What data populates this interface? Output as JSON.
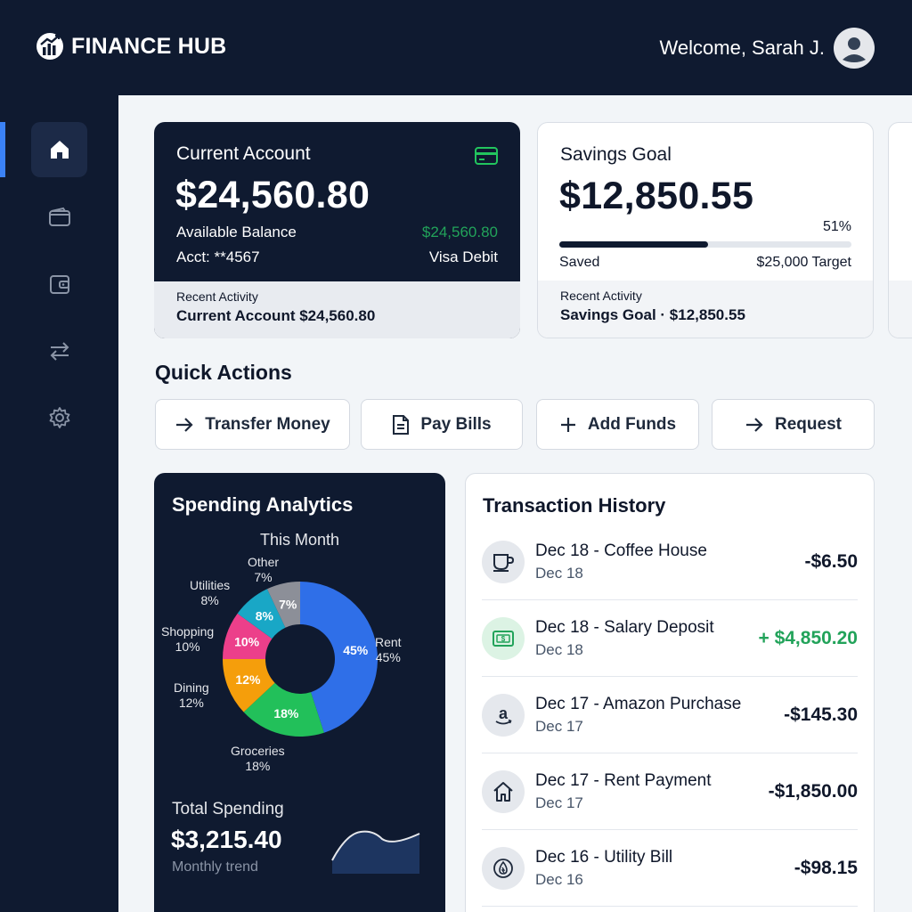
{
  "app": {
    "title": "FINANCE HUB",
    "welcome": "Welcome, Sarah J."
  },
  "colors": {
    "navy": "#0f1a30",
    "accent": "#3b82f6",
    "positive": "#22a35a",
    "card_icon": "#22c55e"
  },
  "sidebar": {
    "items": [
      {
        "icon": "home-icon",
        "active": true
      },
      {
        "icon": "wallet-icon",
        "active": false
      },
      {
        "icon": "wallet-alt-icon",
        "active": false
      },
      {
        "icon": "transfer-icon",
        "active": false
      },
      {
        "icon": "gear-icon",
        "active": false
      }
    ]
  },
  "current_account": {
    "title": "Current Account",
    "amount": "$24,560.80",
    "available_label": "Available Balance",
    "available_value": "$24,560.80",
    "acct_label": "Acct: **4567",
    "card_type": "Visa Debit",
    "recent_label": "Recent Activity",
    "recent_value": "Current Account $24,560.80"
  },
  "savings_goal": {
    "title": "Savings Goal",
    "amount": "$12,850.55",
    "percent_label": "51%",
    "progress": 0.51,
    "saved_label": "Saved",
    "target_label": "$25,000 Target",
    "recent_label": "Recent Activity",
    "recent_value": "Savings Goal · $12,850.55"
  },
  "quick_actions": {
    "title": "Quick Actions",
    "buttons": [
      {
        "label": "Transfer Money",
        "icon": "arrow-right-icon"
      },
      {
        "label": "Pay Bills",
        "icon": "document-icon"
      },
      {
        "label": "Add Funds",
        "icon": "plus-icon"
      },
      {
        "label": "Request",
        "icon": "arrow-right-icon"
      }
    ]
  },
  "analytics": {
    "title": "Spending Analytics",
    "period": "This Month",
    "total_label": "Total Spending",
    "total_value": "$3,215.40",
    "trend_label": "Monthly trend"
  },
  "chart_data": {
    "type": "pie",
    "title": "This Month",
    "categories": [
      "Rent",
      "Groceries",
      "Dining",
      "Shopping",
      "Utilities",
      "Other"
    ],
    "values": [
      45,
      18,
      12,
      10,
      8,
      7
    ],
    "value_labels": [
      "45%",
      "18%",
      "12%",
      "10%",
      "8%",
      "7%"
    ],
    "colors": [
      "#2f6fe8",
      "#22c05a",
      "#f59e0b",
      "#ec3f8a",
      "#19a7c6",
      "#8c8f98"
    ],
    "outer_labels": [
      {
        "name": "Rent",
        "pct": "45%"
      },
      {
        "name": "Groceries",
        "pct": "18%"
      },
      {
        "name": "Dining",
        "pct": "12%"
      },
      {
        "name": "Shopping",
        "pct": "10%"
      },
      {
        "name": "Utilities",
        "pct": "8%"
      },
      {
        "name": "Other",
        "pct": "7%"
      }
    ]
  },
  "transactions": {
    "title": "Transaction History",
    "items": [
      {
        "name": "Dec 18 - Coffee House",
        "date": "Dec 18",
        "amount": "-$6.50",
        "icon": "coffee-cup-icon",
        "positive": false
      },
      {
        "name": "Dec 18 - Salary Deposit",
        "date": "Dec 18",
        "amount": "+ $4,850.20",
        "icon": "money-icon",
        "positive": true
      },
      {
        "name": "Dec 17 - Amazon Purchase",
        "date": "Dec 17",
        "amount": "-$145.30",
        "icon": "amazon-icon",
        "positive": false
      },
      {
        "name": "Dec 17 - Rent Payment",
        "date": "Dec 17",
        "amount": "-$1,850.00",
        "icon": "house-icon",
        "positive": false
      },
      {
        "name": "Dec 16 - Utility Bill",
        "date": "Dec 16",
        "amount": "-$98.15",
        "icon": "flame-icon",
        "positive": false
      }
    ]
  }
}
